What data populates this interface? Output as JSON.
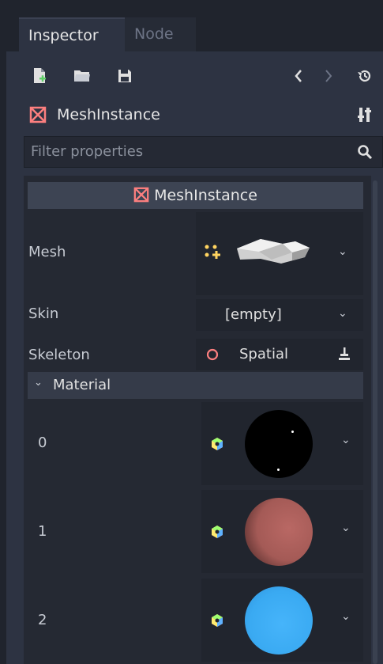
{
  "tabs": [
    {
      "label": "Inspector",
      "active": true
    },
    {
      "label": "Node",
      "active": false
    }
  ],
  "toolbar": {
    "icons": [
      "new-resource-icon",
      "open-folder-icon",
      "save-icon",
      "back-arrow-icon",
      "forward-arrow-icon",
      "history-icon"
    ]
  },
  "node": {
    "name": "MeshInstance",
    "icon": "mesh-instance-icon",
    "settings_icon": "object-properties-icon"
  },
  "filter": {
    "placeholder": "Filter properties"
  },
  "section": {
    "title": "MeshInstance"
  },
  "properties": {
    "mesh": {
      "label": "Mesh"
    },
    "skin": {
      "label": "Skin",
      "value": "[empty]"
    },
    "skeleton": {
      "label": "Skeleton",
      "value": "Spatial"
    }
  },
  "material": {
    "title": "Material",
    "items": [
      {
        "index": "0",
        "color": "#000000"
      },
      {
        "index": "1",
        "color": "#a45a56"
      },
      {
        "index": "2",
        "color": "#3aaaf2"
      }
    ]
  },
  "colors": {
    "accent": "#fc7f7f",
    "panel": "#2d3342",
    "background": "#20242d"
  }
}
